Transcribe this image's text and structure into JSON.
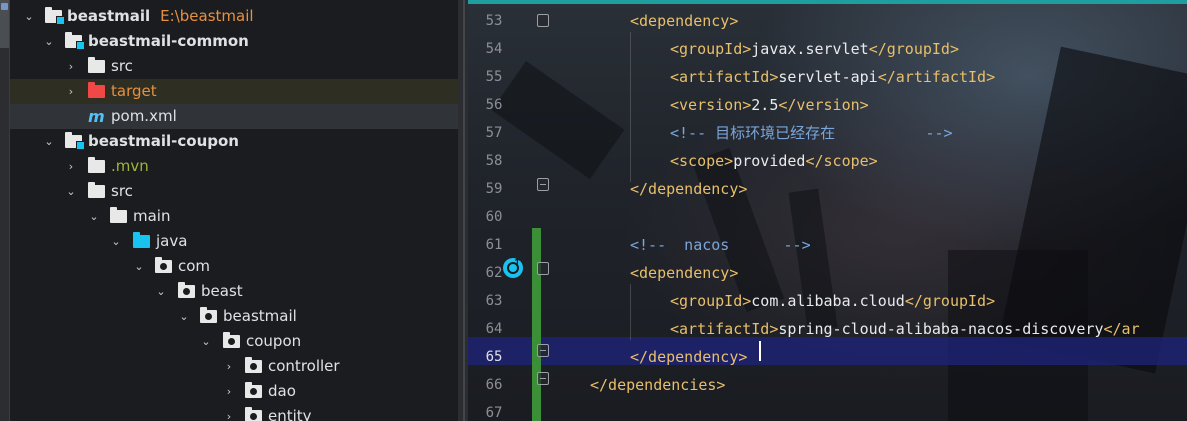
{
  "project_tree": {
    "root": {
      "name": "beastmail",
      "path": "E:\\beastmail"
    },
    "rows": [
      {
        "label": "beastmail",
        "sub": "E:\\beastmail"
      },
      {
        "label": "beastmail-common"
      },
      {
        "label": "src"
      },
      {
        "label": "target"
      },
      {
        "label": "pom.xml"
      },
      {
        "label": "beastmail-coupon"
      },
      {
        "label": ".mvn"
      },
      {
        "label": "src"
      },
      {
        "label": "main"
      },
      {
        "label": "java"
      },
      {
        "label": "com"
      },
      {
        "label": "beast"
      },
      {
        "label": "beastmail"
      },
      {
        "label": "coupon"
      },
      {
        "label": "controller"
      },
      {
        "label": "dao"
      },
      {
        "label": "entity"
      }
    ]
  },
  "editor": {
    "line_numbers": [
      "53",
      "54",
      "55",
      "56",
      "57",
      "58",
      "59",
      "60",
      "61",
      "62",
      "63",
      "64",
      "65",
      "66",
      "67"
    ],
    "lines": [
      {
        "indent": "    ",
        "tokens": [
          {
            "t": "tag",
            "v": "<dependency>"
          }
        ]
      },
      {
        "indent": "        ",
        "tokens": [
          {
            "t": "tag",
            "v": "<groupId>"
          },
          {
            "t": "txt",
            "v": "javax.servlet"
          },
          {
            "t": "tag",
            "v": "</groupId>"
          }
        ]
      },
      {
        "indent": "        ",
        "tokens": [
          {
            "t": "tag",
            "v": "<artifactId>"
          },
          {
            "t": "txt",
            "v": "servlet-api"
          },
          {
            "t": "tag",
            "v": "</artifactId>"
          }
        ]
      },
      {
        "indent": "        ",
        "tokens": [
          {
            "t": "tag",
            "v": "<version>"
          },
          {
            "t": "txt",
            "v": "2.5"
          },
          {
            "t": "tag",
            "v": "</version>"
          }
        ]
      },
      {
        "indent": "        ",
        "tokens": [
          {
            "t": "cmt",
            "v": "<!-- 目标环境已经存在          -->"
          }
        ]
      },
      {
        "indent": "        ",
        "tokens": [
          {
            "t": "tag",
            "v": "<scope>"
          },
          {
            "t": "txt",
            "v": "provided"
          },
          {
            "t": "tag",
            "v": "</scope>"
          }
        ]
      },
      {
        "indent": "    ",
        "tokens": [
          {
            "t": "tag",
            "v": "</dependency>"
          }
        ]
      },
      {
        "indent": "",
        "tokens": []
      },
      {
        "indent": "    ",
        "tokens": [
          {
            "t": "cmt",
            "v": "<!--  nacos      -->"
          }
        ]
      },
      {
        "indent": "    ",
        "tokens": [
          {
            "t": "tag",
            "v": "<dependency>"
          }
        ]
      },
      {
        "indent": "        ",
        "tokens": [
          {
            "t": "tag",
            "v": "<groupId>"
          },
          {
            "t": "txt",
            "v": "com.alibaba.cloud"
          },
          {
            "t": "tag",
            "v": "</groupId>"
          }
        ]
      },
      {
        "indent": "        ",
        "tokens": [
          {
            "t": "tag",
            "v": "<artifactId>"
          },
          {
            "t": "txt",
            "v": "spring-cloud-alibaba-nacos-discovery"
          },
          {
            "t": "tag",
            "v": "</ar"
          }
        ]
      },
      {
        "indent": "    ",
        "tokens": [
          {
            "t": "tag",
            "v": "</dependency>"
          }
        ]
      },
      {
        "indent": "",
        "tokens": [
          {
            "t": "tag",
            "v": "</dependencies>"
          }
        ]
      },
      {
        "indent": "",
        "tokens": []
      }
    ],
    "current_line": "65",
    "accent_color": "#1e9e9e",
    "tag_color": "#e8bf6a",
    "comment_color": "#7aa6da",
    "change_marker_color": "#3b8f36",
    "gutter_icon": "run-gutter-icon"
  }
}
